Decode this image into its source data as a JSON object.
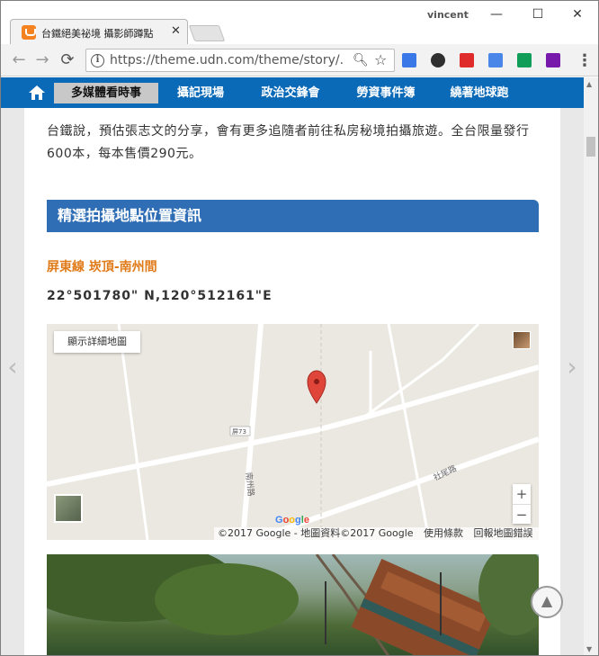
{
  "browser": {
    "tab_title": "台鐵絕美祕境 攝影師蹲點",
    "tab_close": "✕",
    "profile_name": "vincent",
    "url": "https://theme.udn.com/theme/story/...",
    "window_controls": {
      "minimize": "—",
      "maximize": "☐",
      "close": "✕"
    },
    "nav": {
      "back": "←",
      "forward": "→",
      "reload": "⟳"
    },
    "menu": "⋮"
  },
  "site_nav": {
    "items": [
      {
        "label": "多媒體看時事",
        "active": true
      },
      {
        "label": "攝記現場",
        "active": false
      },
      {
        "label": "政治交鋒會",
        "active": false
      },
      {
        "label": "勞資事件簿",
        "active": false
      },
      {
        "label": "繞著地球跑",
        "active": false
      }
    ]
  },
  "article": {
    "paragraph": "台鐵說，預估張志文的分享，會有更多追隨者前往私房秘境拍攝旅遊。全台限量發行600本，每本售價290元。",
    "section_title": "精選拍攝地點位置資訊",
    "location_name": "屏東線 崁頂-南州間",
    "coordinates": "22°501780\" N,120°512161\"E"
  },
  "map": {
    "detail_button": "顯示詳細地圖",
    "road_label_1": "屏73",
    "road_label_2": "南州路",
    "road_label_3": "社尾路",
    "zoom_in": "+",
    "zoom_out": "−",
    "google_logo": "Google",
    "attribution": "©2017 Google - 地圖資料©2017 Google",
    "terms": "使用條款",
    "report": "回報地圖錯誤"
  },
  "page_controls": {
    "prev_arrow": "‹",
    "next_arrow": "›",
    "back_to_top": "▲"
  }
}
